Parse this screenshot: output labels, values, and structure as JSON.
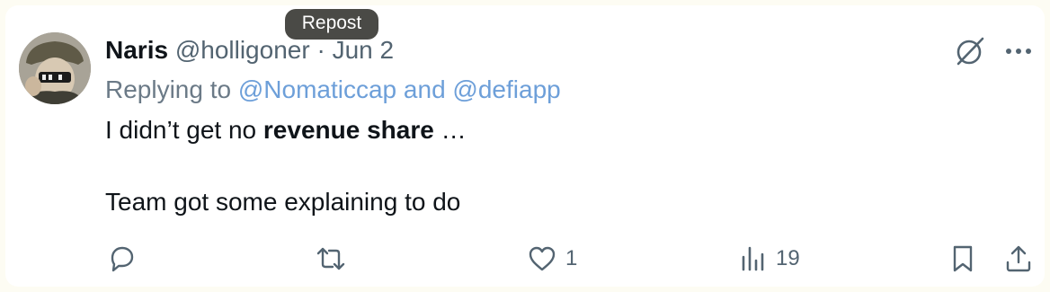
{
  "tooltip": "Repost",
  "post": {
    "author_name": "Naris",
    "handle": "@holligoner",
    "separator": "·",
    "date": "Jun 2",
    "replying_prefix": "Replying to",
    "mention1": "@Nomaticcap",
    "and": "and",
    "mention2": "@defiapp",
    "text_before": "I didn’t get no ",
    "text_bold": "revenue share",
    "text_after": " …",
    "text_line2": "Team got some explaining to do"
  },
  "actions": {
    "reply_count": "",
    "repost_count": "",
    "like_count": "1",
    "views_count": "19"
  },
  "icons": [
    "grok-icon",
    "more-icon",
    "reply-icon",
    "repost-icon",
    "heart-icon",
    "views-icon",
    "bookmark-icon",
    "share-icon"
  ],
  "colors": {
    "text": "#0f1419",
    "muted": "#536471",
    "mention": "#6d9fd9",
    "tooltip_bg": "#4a4a46"
  }
}
